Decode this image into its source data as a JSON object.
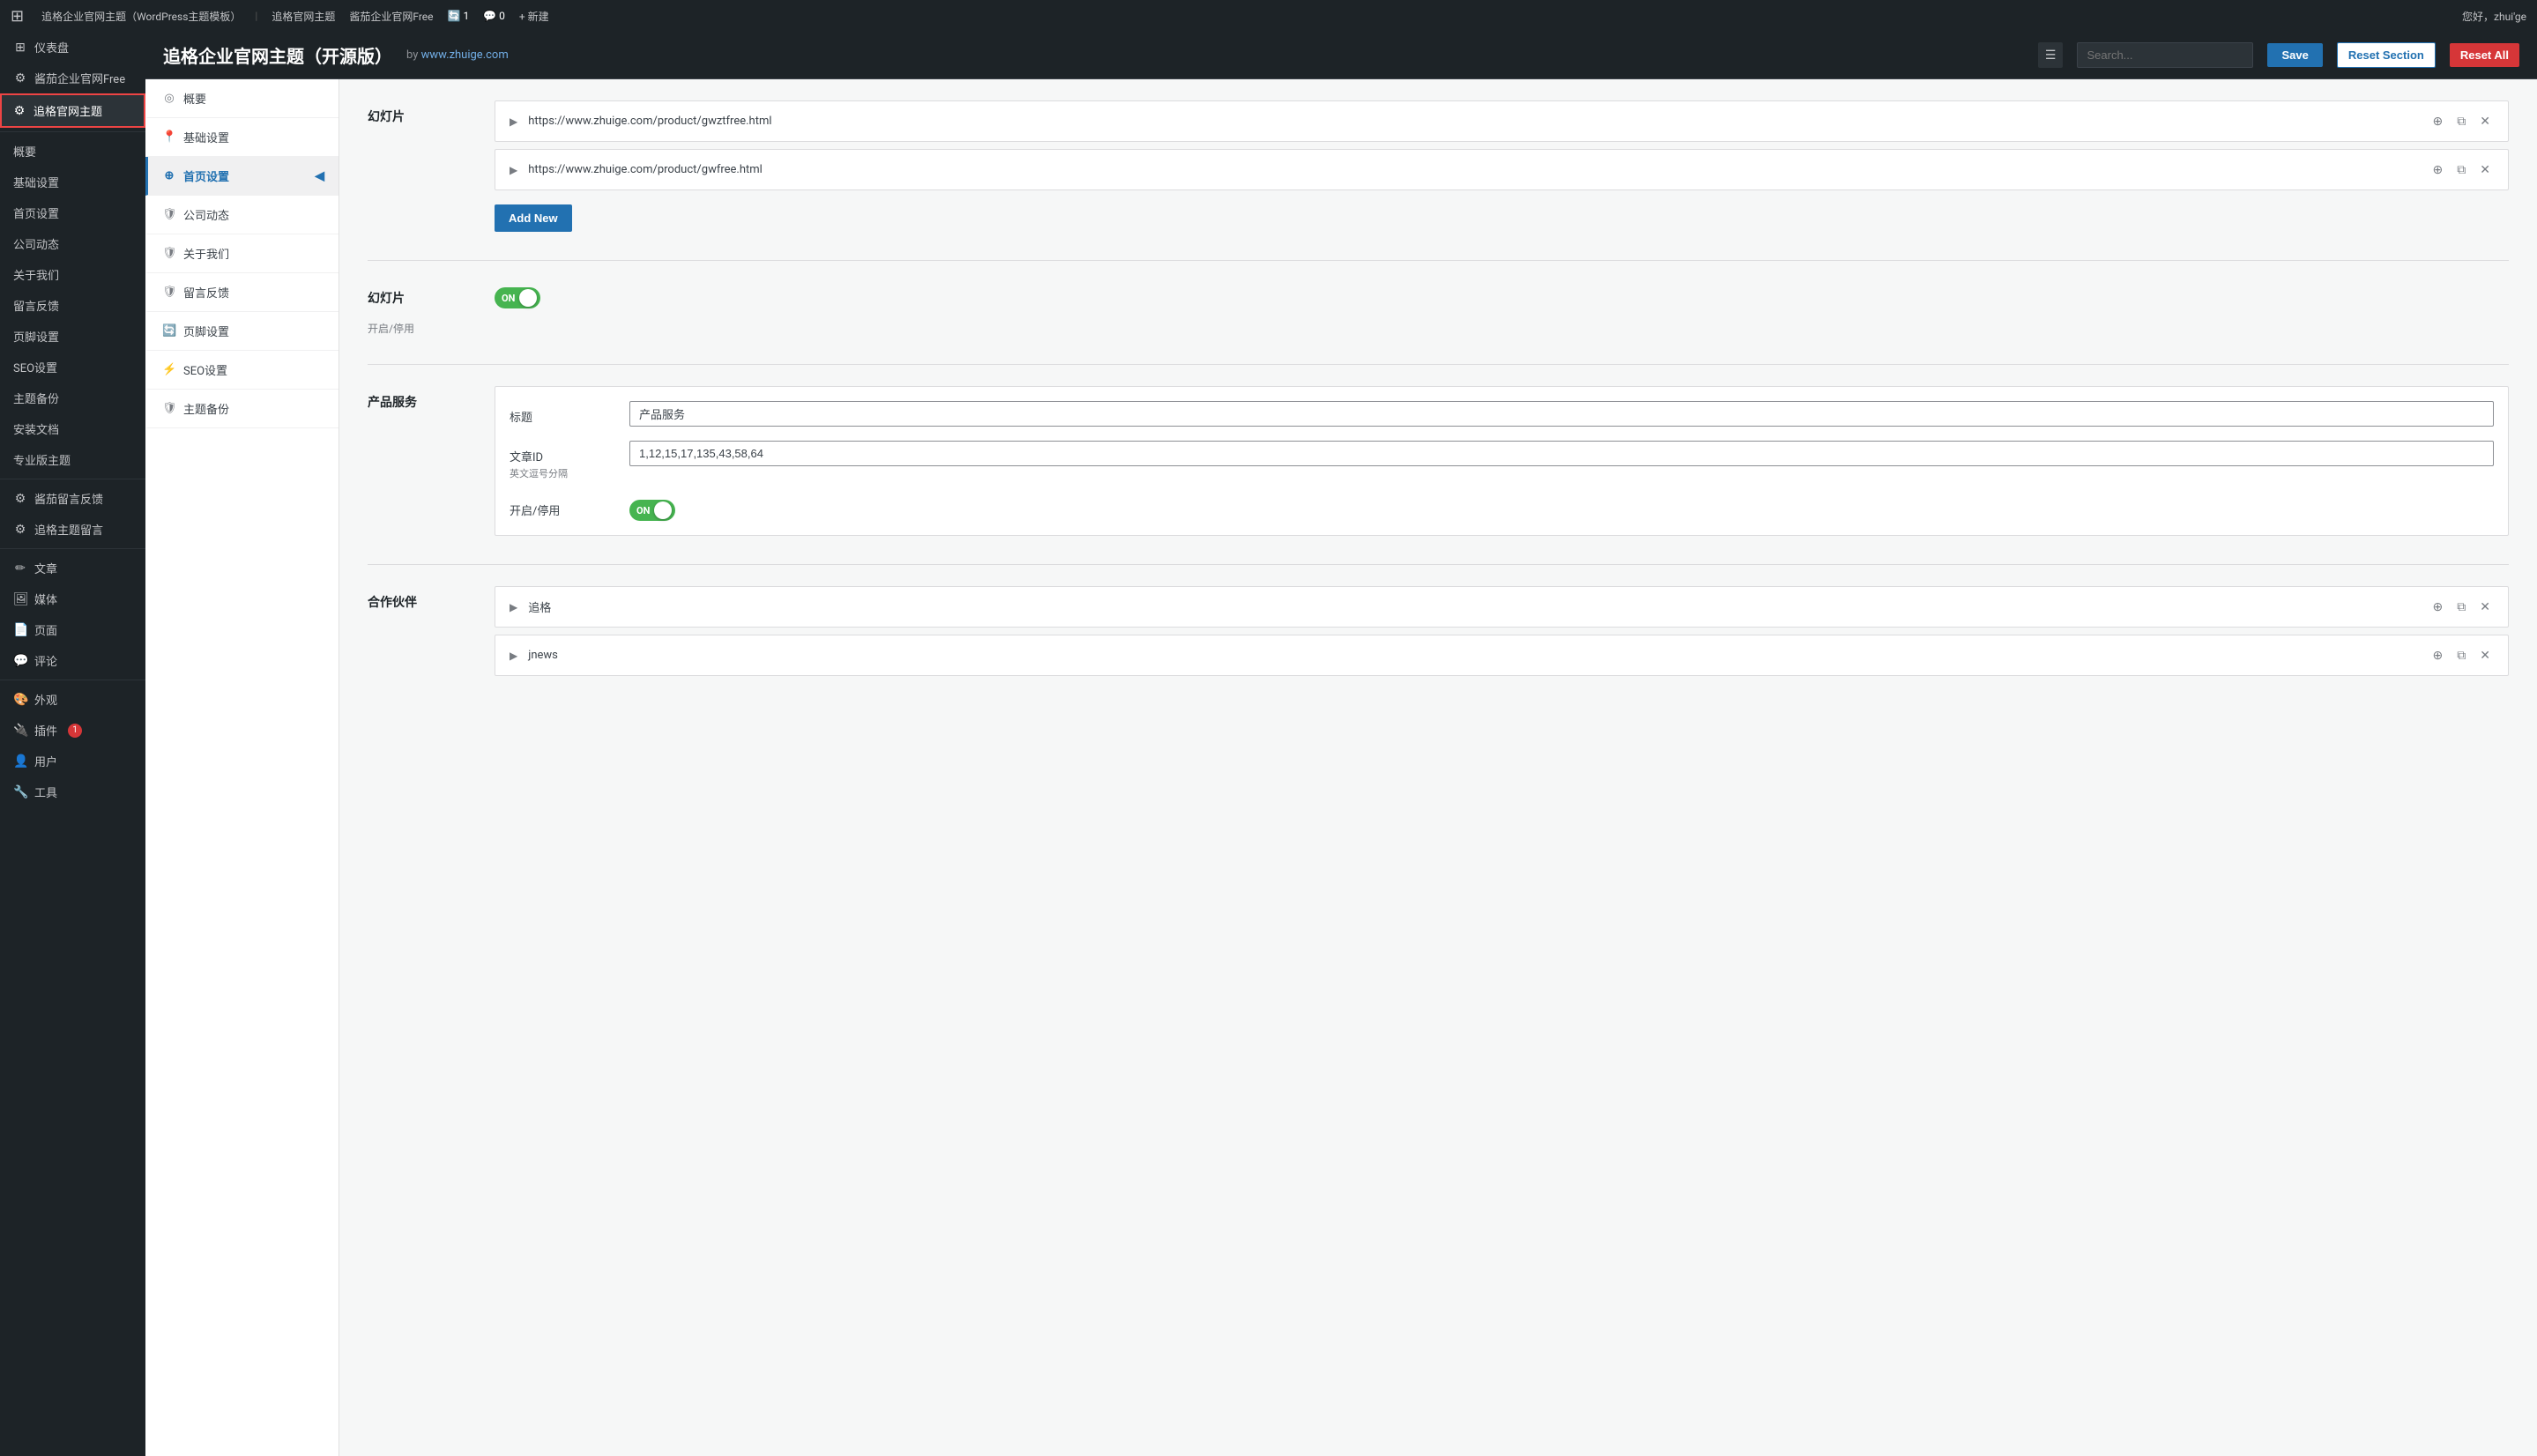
{
  "topbar": {
    "wp_logo": "⚙",
    "site_name": "追格企业官网主题（WordPress主题模板）",
    "breadcrumbs": [
      "追格官网主题",
      "酱茄企业官网Free"
    ],
    "sync_count": "1",
    "comment_count": "0",
    "new_label": "+ 新建",
    "greeting": "您好，zhui'ge"
  },
  "sidebar": {
    "items": [
      {
        "id": "dashboard",
        "icon": "⊞",
        "label": "仪表盘"
      },
      {
        "id": "qiangcha",
        "icon": "⚙",
        "label": "酱茄企业官网Free"
      },
      {
        "id": "active",
        "icon": "⚙",
        "label": "追格官网主题",
        "active": true
      },
      {
        "id": "gaiyo",
        "label": "概要"
      },
      {
        "id": "jichu",
        "label": "基础设置"
      },
      {
        "id": "shouye",
        "label": "首页设置"
      },
      {
        "id": "gongsi",
        "label": "公司动态"
      },
      {
        "id": "guanyu",
        "label": "关于我们"
      },
      {
        "id": "liuyan",
        "label": "留言反馈"
      },
      {
        "id": "yejiao",
        "label": "页脚设置"
      },
      {
        "id": "seo",
        "label": "SEO设置"
      },
      {
        "id": "zhuti",
        "label": "主题备份"
      },
      {
        "id": "anzhuang",
        "label": "安装文档"
      },
      {
        "id": "zhuanye",
        "label": "专业版主题"
      },
      {
        "id": "qiangcha2",
        "icon": "⚙",
        "label": "酱茄留言反馈"
      },
      {
        "id": "zhuige",
        "icon": "⚙",
        "label": "追格主题留言"
      },
      {
        "id": "wenzhang",
        "icon": "✏",
        "label": "文章"
      },
      {
        "id": "meiti",
        "icon": "🖼",
        "label": "媒体"
      },
      {
        "id": "yemian",
        "icon": "📄",
        "label": "页面"
      },
      {
        "id": "pinglun",
        "icon": "💬",
        "label": "评论"
      },
      {
        "id": "waiguan",
        "icon": "🎨",
        "label": "外观"
      },
      {
        "id": "chajian",
        "icon": "🔌",
        "label": "插件",
        "badge": "1"
      },
      {
        "id": "yonghu",
        "icon": "👤",
        "label": "用户"
      },
      {
        "id": "gongju",
        "icon": "🔧",
        "label": "工具"
      }
    ]
  },
  "plugin_header": {
    "title": "追格企业官网主题（开源版）",
    "by_text": "by",
    "site_url": "www.zhuige.com",
    "search_placeholder": "Search...",
    "save_label": "Save",
    "reset_section_label": "Reset Section",
    "reset_all_label": "Reset All"
  },
  "settings_nav": [
    {
      "id": "gaiyo",
      "icon": "◎",
      "label": "概要"
    },
    {
      "id": "jichu",
      "icon": "📍",
      "label": "基础设置"
    },
    {
      "id": "shouye",
      "icon": "⊕",
      "label": "首页设置",
      "active": true,
      "expand": true
    },
    {
      "id": "gongsi",
      "icon": "🛡",
      "label": "公司动态"
    },
    {
      "id": "guanyu",
      "icon": "🛡",
      "label": "关于我们"
    },
    {
      "id": "liuyan",
      "icon": "🛡",
      "label": "留言反馈"
    },
    {
      "id": "yejiao",
      "icon": "🔄",
      "label": "页脚设置"
    },
    {
      "id": "seo",
      "icon": "⚡",
      "label": "SEO设置"
    },
    {
      "id": "backup",
      "icon": "🛡",
      "label": "主题备份"
    }
  ],
  "main_content": {
    "slider_section": {
      "title": "幻灯片",
      "items": [
        {
          "url": "https://www.zhuige.com/product/gwztfree.html"
        },
        {
          "url": "https://www.zhuige.com/product/gwfree.html"
        }
      ],
      "add_new_label": "Add New"
    },
    "slider_toggle_section": {
      "title": "幻灯片",
      "sub_label": "开启/停用",
      "toggle_state": "ON"
    },
    "product_section": {
      "title": "产品服务",
      "fields": {
        "title_label": "标题",
        "title_value": "产品服务",
        "article_id_label": "文章ID",
        "article_id_sublabel": "英文逗号分隔",
        "article_id_value": "1,12,15,17,135,43,58,64",
        "toggle_label": "开启/停用",
        "toggle_state": "ON"
      }
    },
    "partners_section": {
      "title": "合作伙伴",
      "items": [
        {
          "label": "追格"
        },
        {
          "label": "jnews"
        }
      ]
    }
  }
}
